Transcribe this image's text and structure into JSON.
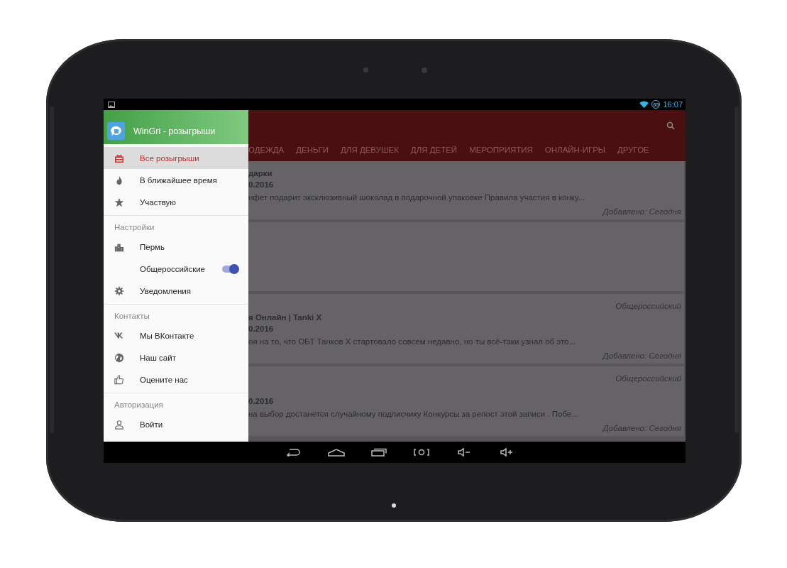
{
  "status_bar": {
    "badge": "65",
    "time": "16:07"
  },
  "drawer": {
    "title": "WinGri - розыгрыши",
    "sections": [
      {
        "items": [
          {
            "kind": "link",
            "label": "Все розыгрыши",
            "selected": true
          },
          {
            "kind": "link",
            "label": "В ближайшее время",
            "selected": false
          },
          {
            "kind": "link",
            "label": "Участвую",
            "selected": false
          }
        ]
      },
      {
        "header": "Настройки",
        "items": [
          {
            "kind": "link",
            "label": "Пермь",
            "selected": false
          },
          {
            "kind": "toggle",
            "label": "Общероссийские",
            "on": true
          },
          {
            "kind": "link",
            "label": "Уведомления",
            "selected": false
          }
        ]
      },
      {
        "header": "Контакты",
        "items": [
          {
            "kind": "link",
            "label": "Мы ВКонтакте",
            "selected": false
          },
          {
            "kind": "link",
            "label": "Наш сайт",
            "selected": false
          },
          {
            "kind": "link",
            "label": "Оцените нас",
            "selected": false
          }
        ]
      },
      {
        "header": "Авторизация",
        "items": [
          {
            "kind": "link",
            "label": "Войти",
            "selected": false
          }
        ]
      }
    ]
  },
  "app_bar": {
    "tabs": [
      {
        "label": "ОДЕЖДА",
        "selected": false
      },
      {
        "label": "ДЕНЬГИ",
        "selected": false
      },
      {
        "label": "ДЛЯ ДЕВУШЕК",
        "selected": false
      },
      {
        "label": "ДЛЯ ДЕТЕЙ",
        "selected": false
      },
      {
        "label": "МЕРОПРИЯТИЯ",
        "selected": false
      },
      {
        "label": "ОНЛАЙН-ИГРЫ",
        "selected": false
      },
      {
        "label": "ДРУГОЕ",
        "selected": false
      }
    ]
  },
  "cards": [
    {
      "kind": "post",
      "title": "дарки",
      "date": "0.2016",
      "description": "нфет подарит эксклюзивный шоколад в подарочной упаковке Правила участия в конку...",
      "added": "Добавлено: Сегодня"
    },
    {
      "kind": "blank"
    },
    {
      "kind": "post",
      "region": "Общероссийский",
      "title": "я Онлайн | Tanki X",
      "date": "0.2016",
      "description": "оя на то, что ОБТ Танков Х стартовало совсем недавно, но ты всё-таки узнал об это...",
      "added": "Добавлено: Сегодня"
    },
    {
      "kind": "post",
      "region": "Общероссийский",
      "date": "0.2016",
      "description": "на выбор достанется случайному подписчику Конкурсы за репост этой записи . Побе...",
      "added": "Добавлено: Сегодня"
    }
  ]
}
